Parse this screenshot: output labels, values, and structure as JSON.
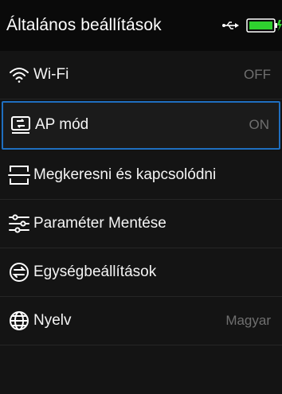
{
  "header": {
    "title": "Általános beállítások",
    "usb_icon": "usb-icon",
    "battery_icon": "battery-charging-icon",
    "battery_color": "#2fd12f"
  },
  "menu": {
    "accent_color": "#1f6fc0",
    "items": [
      {
        "label": "Wi-Fi",
        "value": "OFF",
        "icon": "wifi-icon"
      },
      {
        "label": "AP mód",
        "value": "ON",
        "icon": "ap-mode-icon",
        "selected": true
      },
      {
        "label": "Megkeresni és kapcsolódni",
        "value": "",
        "icon": "scan-icon"
      },
      {
        "label": "Paraméter Mentése",
        "value": "",
        "icon": "sliders-icon"
      },
      {
        "label": "Egységbeállítások",
        "value": "",
        "icon": "unit-settings-icon"
      },
      {
        "label": "Nyelv",
        "value": "Magyar",
        "icon": "globe-icon"
      }
    ]
  }
}
